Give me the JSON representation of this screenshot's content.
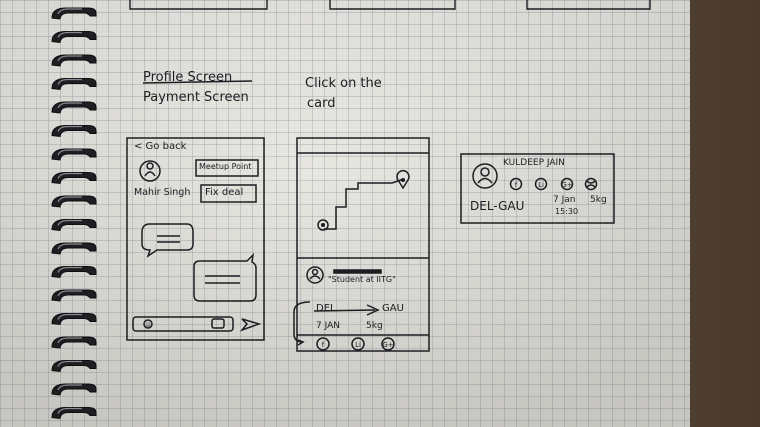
{
  "notes": {
    "struck_title": "Profile Screen",
    "screen_title": "Payment Screen",
    "hint_line1": "Click on the",
    "hint_line2": "card"
  },
  "payment_screen": {
    "back": "< Go back",
    "user_name": "Mahir Singh",
    "meetup_button": "Meetup Point",
    "fix_deal_button": "Fix deal"
  },
  "map_screen": {
    "card_status": "\"Student at IITG\"",
    "from": "DEL",
    "to": "GAU",
    "date": "7 JAN",
    "weight": "5kg"
  },
  "card": {
    "name": "KULDEEP JAIN",
    "route": "DEL-GAU",
    "date": "7 Jan",
    "weight": "5kg",
    "time": "15:30"
  }
}
